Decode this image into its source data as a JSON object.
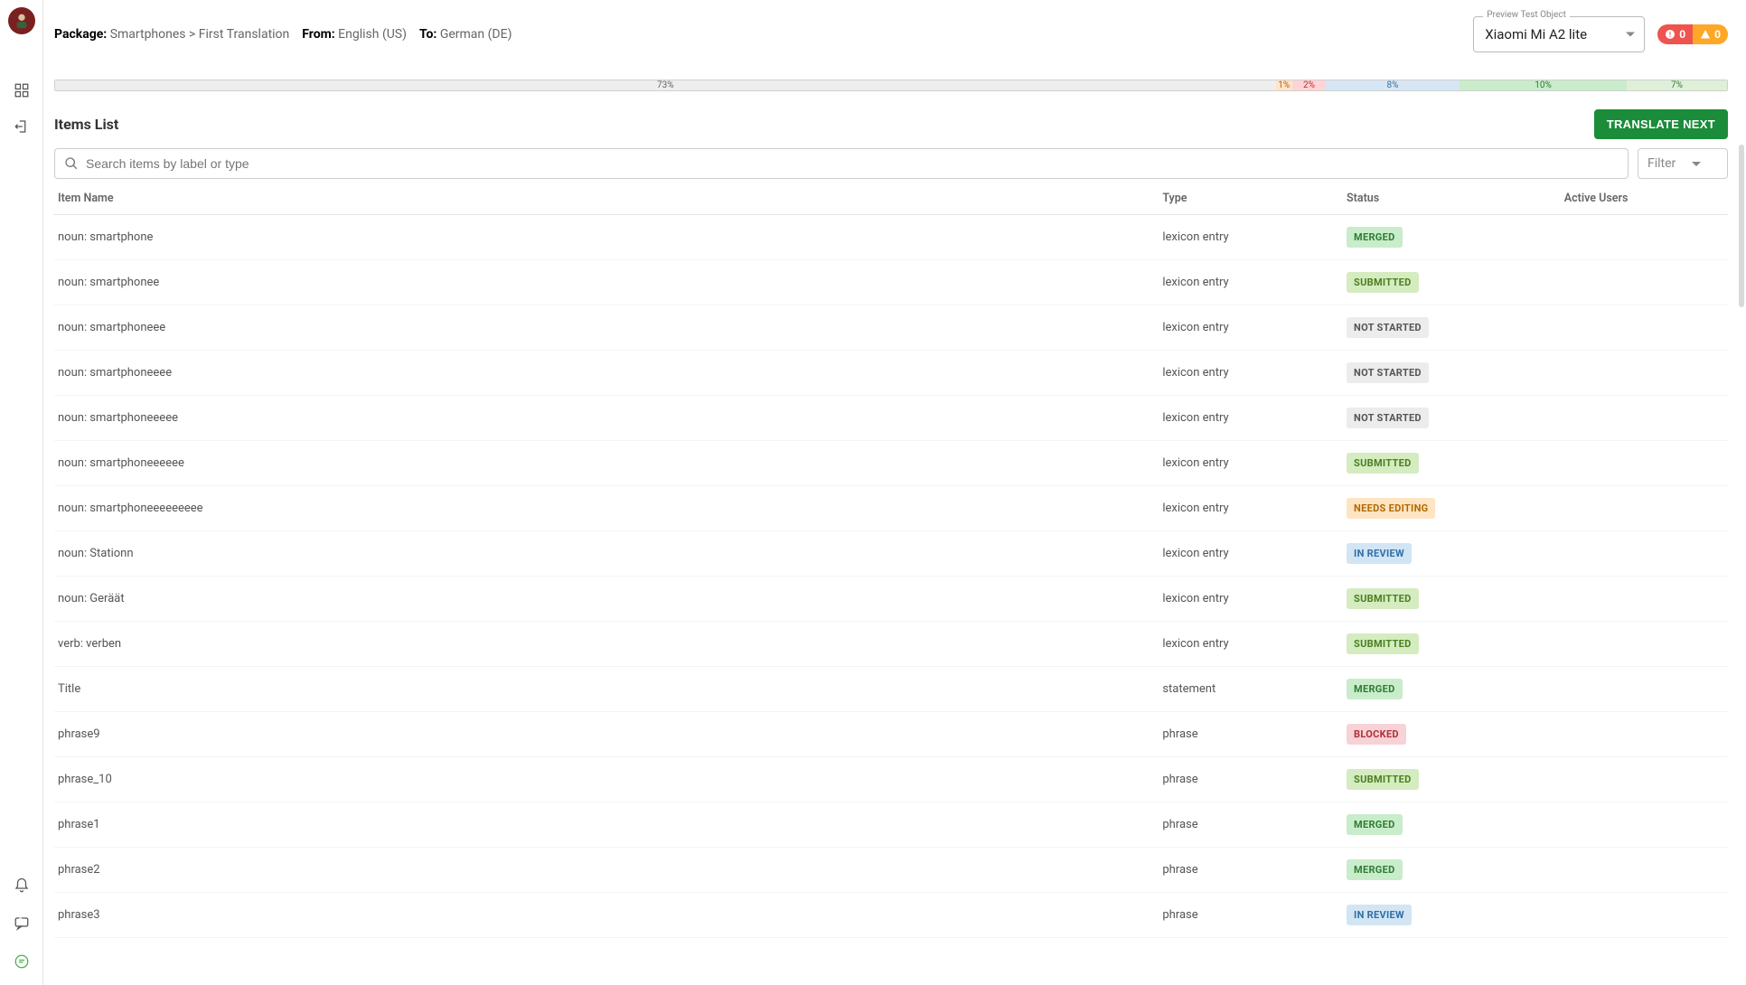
{
  "header": {
    "package_label": "Package:",
    "package_path": "Smartphones > First Translation",
    "from_label": "From:",
    "from_value": "English (US)",
    "to_label": "To:",
    "to_value": "German (DE)",
    "preview_label": "Preview Test Object",
    "preview_value": "Xiaomi Mi A2 lite",
    "error_count": "0",
    "warning_count": "0"
  },
  "progress": {
    "segments": [
      {
        "label": "73%",
        "class": "gray",
        "width": 73
      },
      {
        "label": "1%",
        "class": "orange",
        "width": 1
      },
      {
        "label": "2%",
        "class": "red2",
        "width": 2
      },
      {
        "label": "8%",
        "class": "blue",
        "width": 8
      },
      {
        "label": "10%",
        "class": "green1",
        "width": 10
      },
      {
        "label": "7%",
        "class": "green2",
        "width": 6
      }
    ]
  },
  "list": {
    "title": "Items List",
    "translate_btn": "TRANSLATE NEXT",
    "search_placeholder": "Search items by label or type",
    "filter_label": "Filter",
    "columns": {
      "name": "Item Name",
      "type": "Type",
      "status": "Status",
      "users": "Active Users"
    },
    "rows": [
      {
        "name": "noun: smartphone",
        "type": "lexicon entry",
        "status": "MERGED",
        "status_cls": "status-merged"
      },
      {
        "name": "noun: smartphonee",
        "type": "lexicon entry",
        "status": "SUBMITTED",
        "status_cls": "status-submitted"
      },
      {
        "name": "noun: smartphoneee",
        "type": "lexicon entry",
        "status": "NOT STARTED",
        "status_cls": "status-notstarted"
      },
      {
        "name": "noun: smartphoneeee",
        "type": "lexicon entry",
        "status": "NOT STARTED",
        "status_cls": "status-notstarted"
      },
      {
        "name": "noun: smartphoneeeee",
        "type": "lexicon entry",
        "status": "NOT STARTED",
        "status_cls": "status-notstarted"
      },
      {
        "name": "noun: smartphoneeeeee",
        "type": "lexicon entry",
        "status": "SUBMITTED",
        "status_cls": "status-submitted"
      },
      {
        "name": "noun: smartphoneeeeeeeee",
        "type": "lexicon entry",
        "status": "NEEDS EDITING",
        "status_cls": "status-needsedit"
      },
      {
        "name": "noun: Stationn",
        "type": "lexicon entry",
        "status": "IN REVIEW",
        "status_cls": "status-inreview"
      },
      {
        "name": "noun: Geräät",
        "type": "lexicon entry",
        "status": "SUBMITTED",
        "status_cls": "status-submitted"
      },
      {
        "name": "verb: verben",
        "type": "lexicon entry",
        "status": "SUBMITTED",
        "status_cls": "status-submitted"
      },
      {
        "name": "Title",
        "type": "statement",
        "status": "MERGED",
        "status_cls": "status-merged"
      },
      {
        "name": "phrase9",
        "type": "phrase",
        "status": "BLOCKED",
        "status_cls": "status-blocked"
      },
      {
        "name": "phrase_10",
        "type": "phrase",
        "status": "SUBMITTED",
        "status_cls": "status-submitted"
      },
      {
        "name": "phrase1",
        "type": "phrase",
        "status": "MERGED",
        "status_cls": "status-merged"
      },
      {
        "name": "phrase2",
        "type": "phrase",
        "status": "MERGED",
        "status_cls": "status-merged"
      },
      {
        "name": "phrase3",
        "type": "phrase",
        "status": "IN REVIEW",
        "status_cls": "status-inreview"
      }
    ]
  }
}
